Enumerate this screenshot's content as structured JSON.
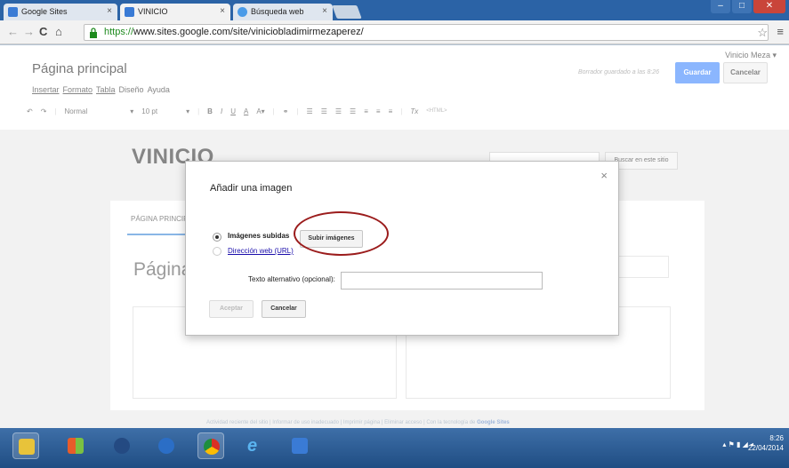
{
  "browser": {
    "tabs": [
      {
        "label": "Google Sites",
        "favicon": "google-sites-icon"
      },
      {
        "label": "VINICIO",
        "favicon": "google-sites-icon"
      },
      {
        "label": "Búsqueda web",
        "favicon": "search-web-icon"
      }
    ],
    "url_scheme": "https://",
    "url_rest": "www.sites.google.com/site/viniciobladimirmezaperez/"
  },
  "editor": {
    "user": "Vinicio Meza ▾",
    "page_heading": "Página principal",
    "menus": [
      "Insertar",
      "Formato",
      "Tabla",
      "Diseño",
      "Ayuda"
    ],
    "draft_status": "Borrador guardado a las 8:26",
    "save_label": "Guardar",
    "cancel_label": "Cancelar",
    "format_style": "Normal",
    "format_size": "10 pt",
    "html_label": "<HTML>"
  },
  "site": {
    "title": "VINICIO",
    "search_button": "Buscar en este sitio",
    "nav_home": "PÁGINA PRINCIPAL",
    "page_title": "Página principal",
    "footer_text": "Actividad reciente del sitio | Informar de uso inadecuado | Imprimir página | Eliminar acceso | Con la tecnología de",
    "footer_brand": "Google Sites"
  },
  "dialog": {
    "title": "Añadir una imagen",
    "option_uploaded": "Imágenes subidas",
    "option_web": "Dirección web (URL)",
    "upload_button": "Subir imágenes",
    "alt_label": "Texto alternativo (opcional):",
    "alt_value": "",
    "accept_label": "Aceptar",
    "cancel_label": "Cancelar",
    "selected_option": "Imágenes subidas",
    "highlight_color": "#9b1c1c"
  },
  "taskbar": {
    "time": "8:26",
    "date": "22/04/2014"
  },
  "colors": {
    "accent": "#4d90fe",
    "link": "#1a0dab",
    "tabstrip": "#2b63a6"
  }
}
